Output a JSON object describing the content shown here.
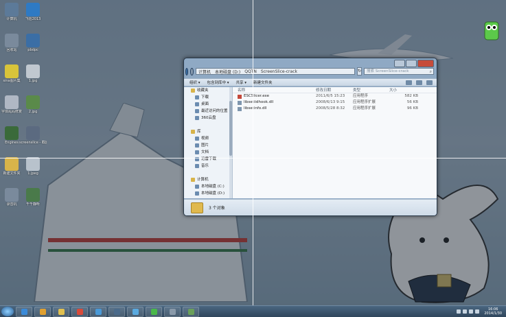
{
  "desktop": {
    "icons": [
      {
        "label": "计算机",
        "color": "#5c7a99"
      },
      {
        "label": "飞信2013",
        "color": "#2e7ac4"
      },
      {
        "label": "回收站",
        "color": "#7a8a9c"
      },
      {
        "label": "pbdpc",
        "color": "#3b6ea5"
      },
      {
        "label": "sina图片集",
        "color": "#d8c43a"
      },
      {
        "label": "1.jpg",
        "color": "#c0c8d0"
      },
      {
        "label": "字体乱码修复",
        "color": "#b0b8c4"
      },
      {
        "label": "2.jpg",
        "color": "#5a8a4a"
      },
      {
        "label": "Engines",
        "color": "#3a6a3a"
      },
      {
        "label": "screenslice - 截图",
        "color": "#5b6a80"
      },
      {
        "label": "新建文件夹",
        "color": "#d8b44a"
      },
      {
        "label": "1.jpeg",
        "color": "#b8c2cc"
      },
      {
        "label": "录音机",
        "color": "#7a8a9c"
      },
      {
        "label": "千千静听",
        "color": "#4a7a4a"
      }
    ]
  },
  "explorer": {
    "address": {
      "segments": [
        "计算机",
        "本地磁盘 (D:)",
        "QQTN",
        "ScreenSlice-crack"
      ]
    },
    "search_placeholder": "搜索 ScreenSlice-crack",
    "toolbar": {
      "organize": "组织 ▾",
      "include": "包含到库中 ▾",
      "share": "共享 ▾",
      "new_folder": "新建文件夹"
    },
    "nav": [
      {
        "label": "收藏夹",
        "group": true
      },
      {
        "label": "下载",
        "group": false
      },
      {
        "label": "桌面",
        "group": false
      },
      {
        "label": "最近访问的位置",
        "group": false
      },
      {
        "label": "360云盘",
        "group": false
      },
      {
        "label": "",
        "group": false
      },
      {
        "label": "库",
        "group": true
      },
      {
        "label": "视频",
        "group": false
      },
      {
        "label": "图片",
        "group": false
      },
      {
        "label": "文档",
        "group": false
      },
      {
        "label": "迅雷下载",
        "group": false
      },
      {
        "label": "音乐",
        "group": false
      },
      {
        "label": "",
        "group": false
      },
      {
        "label": "计算机",
        "group": true
      },
      {
        "label": "本地磁盘 (C:)",
        "group": false
      },
      {
        "label": "本地磁盘 (D:)",
        "group": false
      }
    ],
    "columns": {
      "name": "名称",
      "date": "修改日期",
      "type": "类型",
      "size": "大小"
    },
    "files": [
      {
        "name": "ESCSlicer.exe",
        "date": "2011/6/5 15:23",
        "type": "应用程序",
        "size": "582 KB",
        "exe": true
      },
      {
        "name": "libsetiidhook.dll",
        "date": "2008/6/13 9:15",
        "type": "应用程序扩展",
        "size": "56 KB",
        "exe": false
      },
      {
        "name": "libsetinfo.dll",
        "date": "2008/5/28 8:32",
        "type": "应用程序扩展",
        "size": "96 KB",
        "exe": false
      }
    ],
    "status": "3 个对象"
  },
  "taskbar": {
    "apps": [
      {
        "name": "ie-icon",
        "color": "#3a8ad8"
      },
      {
        "name": "media-player-icon",
        "color": "#e0a030"
      },
      {
        "name": "folder-icon",
        "color": "#e0c050"
      },
      {
        "name": "chrome-icon",
        "color": "#d84a3a"
      },
      {
        "name": "fetion-icon",
        "color": "#4a9ad8"
      },
      {
        "name": "screenslice-icon",
        "color": "#4a6a8a"
      },
      {
        "name": "qq-icon",
        "color": "#5aaae0"
      },
      {
        "name": "360-icon",
        "color": "#4ab84a"
      },
      {
        "name": "tool-icon",
        "color": "#8a9aaa"
      },
      {
        "name": "game-icon",
        "color": "#6aa05a"
      }
    ],
    "clock_time": "16:06",
    "clock_date": "2014/1/30"
  }
}
